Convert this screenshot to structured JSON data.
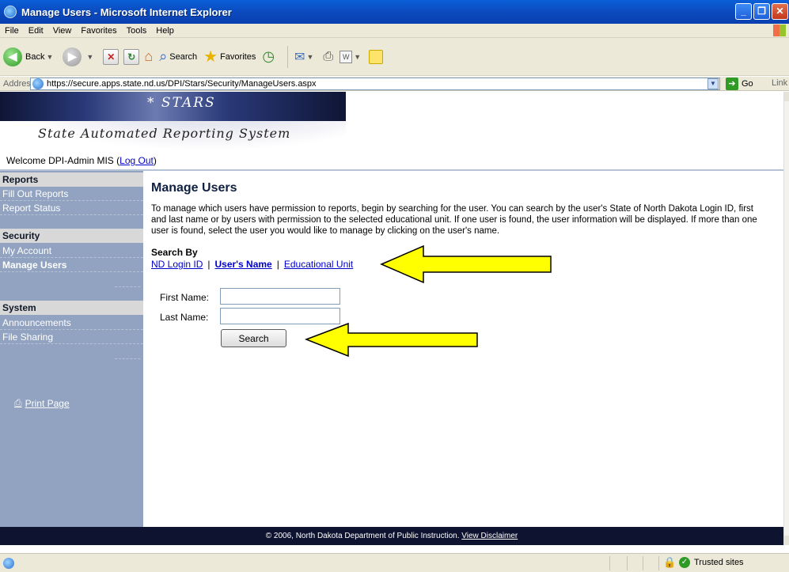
{
  "window": {
    "title": "Manage Users - Microsoft Internet Explorer",
    "controls": {
      "minimize": "_",
      "restore": "❐",
      "close": "✕"
    }
  },
  "menu": [
    "File",
    "Edit",
    "View",
    "Favorites",
    "Tools",
    "Help"
  ],
  "toolbar": {
    "back_label": "Back",
    "search_label": "Search",
    "favorites_label": "Favorites"
  },
  "address": {
    "label": "Address",
    "url": "https://secure.apps.state.nd.us/DPI/Stars/Security/ManageUsers.aspx",
    "go_label": "Go",
    "links_label": "Link"
  },
  "banner": {
    "title": "* STARS",
    "subtitle": "State Automated Reporting System"
  },
  "welcome": {
    "text": "Welcome DPI-Admin MIS (",
    "logout": "Log Out",
    "close_paren": ")"
  },
  "sidebar": {
    "sections": [
      {
        "title": "Reports",
        "items": [
          "Fill Out Reports",
          "Report Status"
        ]
      },
      {
        "title": "Security",
        "items": [
          "My Account",
          "Manage Users"
        ]
      },
      {
        "title": "System",
        "items": [
          "Announcements",
          "File Sharing"
        ]
      }
    ],
    "active_item": "Manage Users",
    "print_label": "Print Page"
  },
  "main": {
    "title": "Manage Users",
    "description": "To manage which users have permission to reports, begin by searching for the user. You can search by the user's State of North Dakota Login ID, first and last name or by users with permission to the selected educational unit. If one user is found, the user information will be displayed. If more than one user is found, select the user you would like to manage by clicking on the user's name.",
    "search_by": {
      "label": "Search By",
      "options": [
        "ND Login ID",
        "User's Name",
        "Educational Unit"
      ],
      "selected": "User's Name",
      "separator": "|"
    },
    "form": {
      "first_name_label": "First Name:",
      "first_name_value": "",
      "last_name_label": "Last Name:",
      "last_name_value": "",
      "search_button": "Search"
    }
  },
  "footer": {
    "text": "© 2006, North Dakota Department of Public Instruction.",
    "disclaimer": "View Disclaimer"
  },
  "status": {
    "zone": "Trusted sites"
  },
  "colors": {
    "sidebar_bg": "#91a3c0",
    "footer_bg": "#0e1430",
    "highlight_arrow": "#ffff00",
    "link": "#0000cc"
  }
}
